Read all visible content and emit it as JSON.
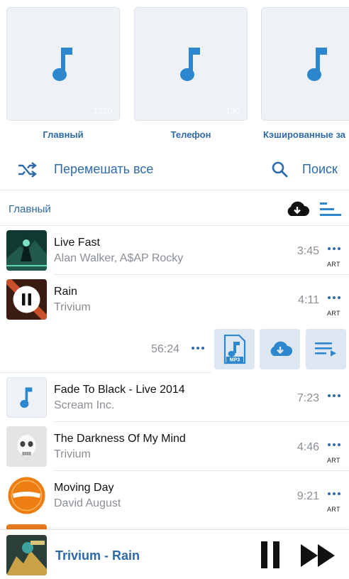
{
  "playlists": [
    {
      "label": "Главный",
      "count": "1220",
      "icon": "music-note-icon"
    },
    {
      "label": "Телефон",
      "count": "130",
      "icon": "music-note-icon"
    },
    {
      "label": "Кэшированные за",
      "count": "",
      "icon": "music-note-icon"
    }
  ],
  "actions": {
    "shuffle_label": "Перемешать все",
    "search_label": "Поиск"
  },
  "section": {
    "title": "Главный"
  },
  "tracks": [
    {
      "title": "Live Fast",
      "artist": "Alan Walker, A$AP Rocky",
      "duration": "3:45",
      "badge": "ART"
    },
    {
      "title": "Rain",
      "artist": "Trivium",
      "duration": "4:11",
      "badge": "ART",
      "playing": true
    },
    {
      "title": "Fade To Black - Live 2014",
      "artist": "Scream Inc.",
      "duration": "7:23",
      "badge": ""
    },
    {
      "title": "The Darkness Of My Mind",
      "artist": "Trivium",
      "duration": "4:46",
      "badge": "ART"
    },
    {
      "title": "Moving Day",
      "artist": "David August",
      "duration": "9:21",
      "badge": "ART"
    }
  ],
  "expanded": {
    "total_duration": "56:24",
    "mp3_label": "MP3"
  },
  "player": {
    "now_playing": "Trivium - Rain"
  },
  "colors": {
    "accent": "#2f6aa8",
    "icon_blue": "#2d87cf",
    "muted": "#8a8f96",
    "tile_bg": "#eef2f6"
  }
}
